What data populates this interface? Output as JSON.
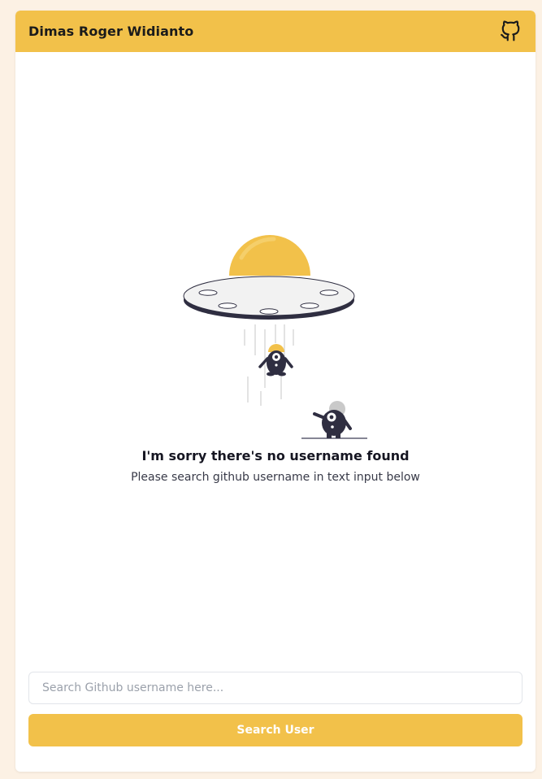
{
  "header": {
    "title": "Dimas Roger Widianto",
    "github_icon": "github-icon"
  },
  "empty_state": {
    "illustration": "ufo-abduction-illustration",
    "title": "I'm sorry there's no username found",
    "subtitle": "Please search github username in text input below"
  },
  "search": {
    "placeholder": "Search Github username here...",
    "value": "",
    "button_label": "Search User"
  },
  "colors": {
    "accent": "#f2c14a",
    "page_background": "#fcf1e4",
    "card_background": "#ffffff",
    "ink": "#2f2e41"
  }
}
